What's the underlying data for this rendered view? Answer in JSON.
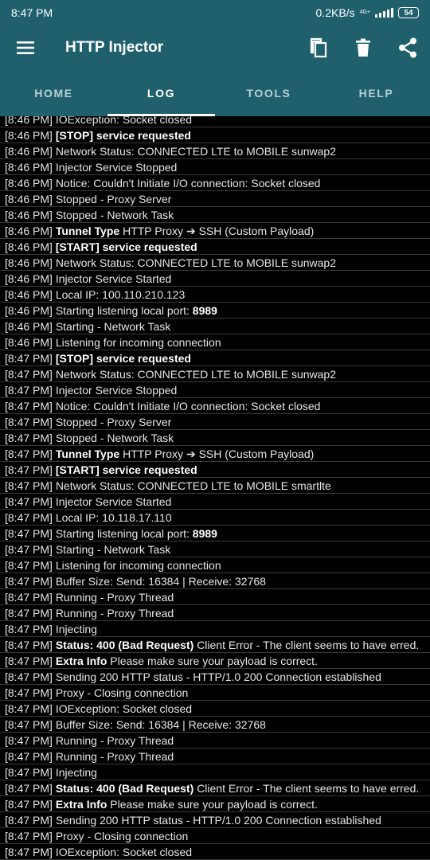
{
  "status_bar": {
    "time": "8:47 PM",
    "speed": "0.2KB/s",
    "network": "4G+",
    "battery": "54"
  },
  "app_bar": {
    "title": "HTTP Injector",
    "icons": [
      "menu-icon",
      "copy-icon",
      "delete-icon",
      "share-icon"
    ]
  },
  "tabs": [
    {
      "label": "HOME",
      "active": false
    },
    {
      "label": "LOG",
      "active": true
    },
    {
      "label": "TOOLS",
      "active": false
    },
    {
      "label": "HELP",
      "active": false
    }
  ],
  "log": [
    {
      "time": "[8:46 PM]",
      "bold": "",
      "text": "IOException: Socket closed"
    },
    {
      "time": "[8:46 PM]",
      "bold": "[STOP] service requested",
      "text": ""
    },
    {
      "time": "[8:46 PM]",
      "bold": "",
      "text": "Network Status: CONNECTED LTE to MOBILE sunwap2"
    },
    {
      "time": "[8:46 PM]",
      "bold": "",
      "text": "Injector Service Stopped"
    },
    {
      "time": "[8:46 PM]",
      "bold": "",
      "text": "Notice: Couldn't Initiate I/O connection: Socket closed"
    },
    {
      "time": "[8:46 PM]",
      "bold": "",
      "text": "Stopped - Proxy Server"
    },
    {
      "time": "[8:46 PM]",
      "bold": "",
      "text": "Stopped - Network Task"
    },
    {
      "time": "[8:46 PM]",
      "bold": "Tunnel Type",
      "text": "HTTP Proxy ➔ SSH (Custom Payload)"
    },
    {
      "time": "[8:46 PM]",
      "bold": "[START] service requested",
      "text": ""
    },
    {
      "time": "[8:46 PM]",
      "bold": "",
      "text": "Network Status: CONNECTED LTE to MOBILE sunwap2"
    },
    {
      "time": "[8:46 PM]",
      "bold": "",
      "text": "Injector Service Started"
    },
    {
      "time": "[8:46 PM]",
      "bold": "",
      "text": "Local IP: 100.110.210.123"
    },
    {
      "time": "[8:46 PM]",
      "bold": "",
      "text": "Starting listening local port:",
      "tail": "8989"
    },
    {
      "time": "[8:46 PM]",
      "bold": "",
      "text": "Starting - Network Task"
    },
    {
      "time": "[8:46 PM]",
      "bold": "",
      "text": "Listening for incoming connection"
    },
    {
      "time": "[8:47 PM]",
      "bold": "[STOP] service requested",
      "text": ""
    },
    {
      "time": "[8:47 PM]",
      "bold": "",
      "text": "Network Status: CONNECTED LTE to MOBILE sunwap2"
    },
    {
      "time": "[8:47 PM]",
      "bold": "",
      "text": "Injector Service Stopped"
    },
    {
      "time": "[8:47 PM]",
      "bold": "",
      "text": "Notice: Couldn't Initiate I/O connection: Socket closed"
    },
    {
      "time": "[8:47 PM]",
      "bold": "",
      "text": "Stopped - Proxy Server"
    },
    {
      "time": "[8:47 PM]",
      "bold": "",
      "text": "Stopped - Network Task"
    },
    {
      "time": "[8:47 PM]",
      "bold": "Tunnel Type",
      "text": "HTTP Proxy ➔ SSH (Custom Payload)"
    },
    {
      "time": "[8:47 PM]",
      "bold": "[START] service requested",
      "text": ""
    },
    {
      "time": "[8:47 PM]",
      "bold": "",
      "text": "Network Status: CONNECTED LTE to MOBILE smartlte"
    },
    {
      "time": "[8:47 PM]",
      "bold": "",
      "text": "Injector Service Started"
    },
    {
      "time": "[8:47 PM]",
      "bold": "",
      "text": "Local IP: 10.118.17.110"
    },
    {
      "time": "[8:47 PM]",
      "bold": "",
      "text": "Starting listening local port:",
      "tail": "8989"
    },
    {
      "time": "[8:47 PM]",
      "bold": "",
      "text": "Starting - Network Task"
    },
    {
      "time": "[8:47 PM]",
      "bold": "",
      "text": "Listening for incoming connection"
    },
    {
      "time": "[8:47 PM]",
      "bold": "",
      "text": "Buffer Size: Send: 16384 | Receive: 32768"
    },
    {
      "time": "[8:47 PM]",
      "bold": "",
      "text": "Running - Proxy Thread"
    },
    {
      "time": "[8:47 PM]",
      "bold": "",
      "text": "Running - Proxy Thread"
    },
    {
      "time": "[8:47 PM]",
      "bold": "",
      "text": "Injecting"
    },
    {
      "time": "[8:47 PM]",
      "bold": "Status: 400 (Bad Request)",
      "text": "Client Error - The client seems to have erred."
    },
    {
      "time": "[8:47 PM]",
      "bold": "Extra Info",
      "text": "Please make sure your payload is correct."
    },
    {
      "time": "[8:47 PM]",
      "bold": "",
      "text": "Sending 200 HTTP status - HTTP/1.0 200 Connection established"
    },
    {
      "time": "[8:47 PM]",
      "bold": "",
      "text": "Proxy - Closing connection"
    },
    {
      "time": "[8:47 PM]",
      "bold": "",
      "text": "IOException: Socket closed"
    },
    {
      "time": "[8:47 PM]",
      "bold": "",
      "text": "Buffer Size: Send: 16384 | Receive: 32768"
    },
    {
      "time": "[8:47 PM]",
      "bold": "",
      "text": "Running - Proxy Thread"
    },
    {
      "time": "[8:47 PM]",
      "bold": "",
      "text": "Running - Proxy Thread"
    },
    {
      "time": "[8:47 PM]",
      "bold": "",
      "text": "Injecting"
    },
    {
      "time": "[8:47 PM]",
      "bold": "Status: 400 (Bad Request)",
      "text": "Client Error - The client seems to have erred."
    },
    {
      "time": "[8:47 PM]",
      "bold": "Extra Info",
      "text": "Please make sure your payload is correct."
    },
    {
      "time": "[8:47 PM]",
      "bold": "",
      "text": "Sending 200 HTTP status - HTTP/1.0 200 Connection established"
    },
    {
      "time": "[8:47 PM]",
      "bold": "",
      "text": "Proxy - Closing connection"
    },
    {
      "time": "[8:47 PM]",
      "bold": "",
      "text": "IOException: Socket closed"
    }
  ]
}
